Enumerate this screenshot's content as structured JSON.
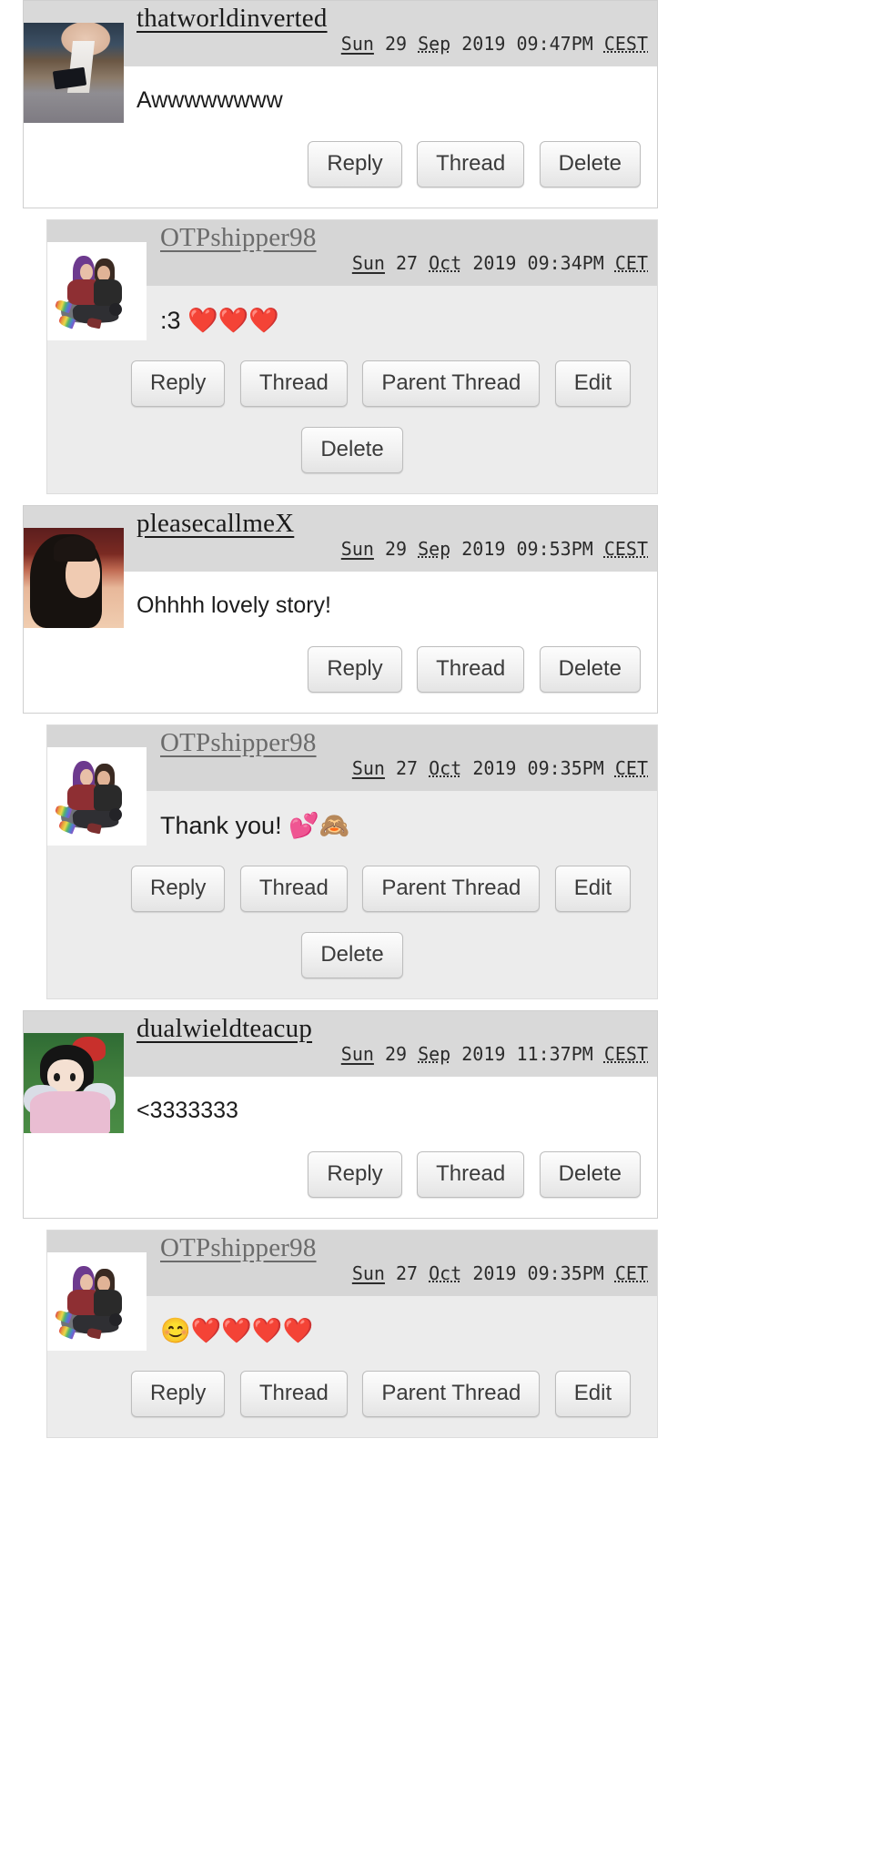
{
  "comments": [
    {
      "id": "c1",
      "level": 1,
      "username": "thatworldinverted",
      "date": {
        "weekday": "Sun",
        "day": "29",
        "month": "Sep",
        "year": "2019",
        "time": "09:47PM",
        "tz": "CEST"
      },
      "text": "Awwwwwwww",
      "avatar": "desk-reading-photo",
      "actions": [
        "Reply",
        "Thread",
        "Delete"
      ],
      "actions_row2": []
    },
    {
      "id": "c2",
      "level": 2,
      "username": "OTPshipper98",
      "date": {
        "weekday": "Sun",
        "day": "27",
        "month": "Oct",
        "year": "2019",
        "time": "09:34PM",
        "tz": "CET"
      },
      "text": ":3 ❤️❤️❤️",
      "avatar": "couple-hugging-art",
      "actions": [
        "Reply",
        "Thread",
        "Parent Thread",
        "Edit"
      ],
      "actions_row2": [
        "Delete"
      ]
    },
    {
      "id": "c3",
      "level": 1,
      "username": "pleasecallmeX",
      "date": {
        "weekday": "Sun",
        "day": "29",
        "month": "Sep",
        "year": "2019",
        "time": "09:53PM",
        "tz": "CEST"
      },
      "text": "Ohhhh lovely story!",
      "avatar": "woman-portrait-art",
      "actions": [
        "Reply",
        "Thread",
        "Delete"
      ],
      "actions_row2": []
    },
    {
      "id": "c4",
      "level": 2,
      "username": "OTPshipper98",
      "date": {
        "weekday": "Sun",
        "day": "27",
        "month": "Oct",
        "year": "2019",
        "time": "09:35PM",
        "tz": "CET"
      },
      "text": "Thank you! 💕🙈",
      "avatar": "couple-hugging-art",
      "actions": [
        "Reply",
        "Thread",
        "Parent Thread",
        "Edit"
      ],
      "actions_row2": [
        "Delete"
      ]
    },
    {
      "id": "c5",
      "level": 1,
      "username": "dualwieldteacup",
      "date": {
        "weekday": "Sun",
        "day": "29",
        "month": "Sep",
        "year": "2019",
        "time": "11:37PM",
        "tz": "CEST"
      },
      "text": "<3333333",
      "avatar": "kiki-grass-photo",
      "actions": [
        "Reply",
        "Thread",
        "Delete"
      ],
      "actions_row2": []
    },
    {
      "id": "c6",
      "level": 2,
      "username": "OTPshipper98",
      "date": {
        "weekday": "Sun",
        "day": "27",
        "month": "Oct",
        "year": "2019",
        "time": "09:35PM",
        "tz": "CET"
      },
      "text": "😊❤️❤️❤️❤️",
      "avatar": "couple-hugging-art",
      "actions": [
        "Reply",
        "Thread",
        "Parent Thread",
        "Edit"
      ],
      "actions_row2": []
    }
  ],
  "colors": {
    "header_bg": "#d9d9d9",
    "nested_bg": "#ececec",
    "page_bg": "#ffffff",
    "username_link": "#1a1a1a",
    "username_link_nested": "#6b6b6b",
    "button_text": "#3b3b3b"
  }
}
